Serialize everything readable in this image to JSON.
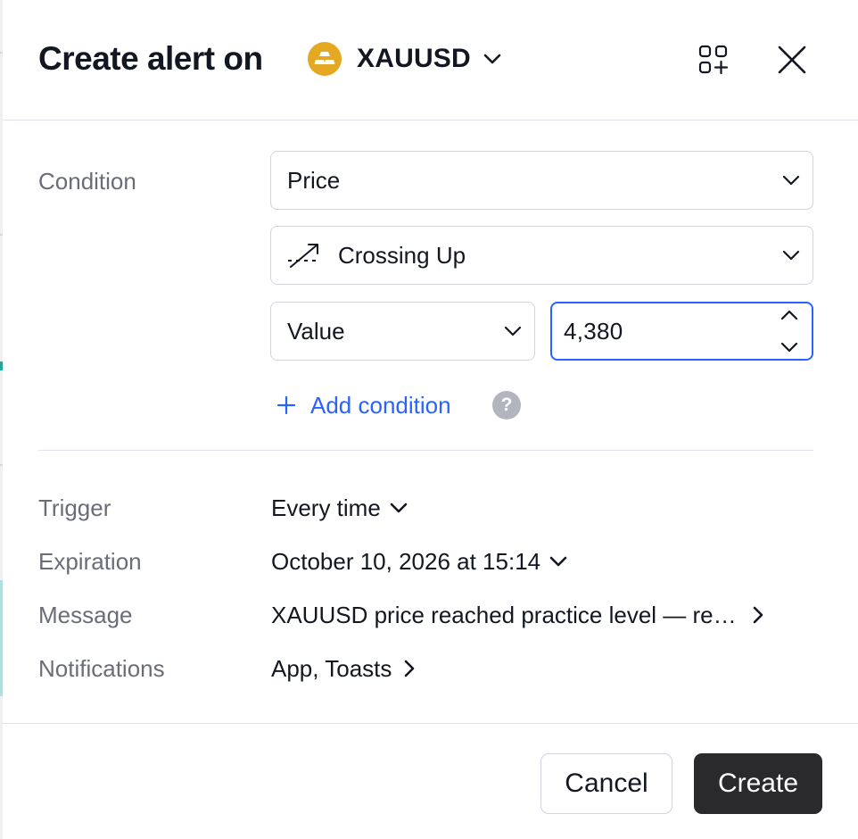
{
  "header": {
    "title": "Create alert on",
    "symbol": {
      "name": "XAUUSD",
      "logo_icon": "gold-bars-icon",
      "logo_color": "#e5a823"
    },
    "icons": [
      "add-widget-icon",
      "close-icon"
    ]
  },
  "condition": {
    "label": "Condition",
    "source": "Price",
    "operator": "Crossing Up",
    "operator_icon": "crossing-up-icon",
    "value_type": "Value",
    "value": "4,380",
    "add_condition_label": "Add condition",
    "help_symbol": "?"
  },
  "settings": [
    {
      "label": "Trigger",
      "value": "Every time",
      "control": "dropdown"
    },
    {
      "label": "Expiration",
      "value": "October 10, 2026 at 15:14",
      "control": "dropdown"
    },
    {
      "label": "Message",
      "value": "XAUUSD price reached practice level — re…",
      "control": "navigate"
    },
    {
      "label": "Notifications",
      "value": "App, Toasts",
      "control": "navigate"
    }
  ],
  "footer": {
    "cancel_label": "Cancel",
    "create_label": "Create"
  },
  "colors": {
    "accent": "#2962ff",
    "primary_button": "#2a2a2c",
    "label_text": "#6a6d78",
    "border": "#d1d4dc"
  }
}
